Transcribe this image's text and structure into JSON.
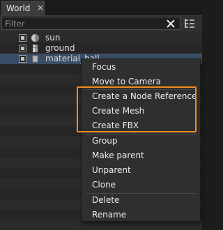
{
  "tab": {
    "label": "World",
    "close_glyph": "×"
  },
  "toolbar": {
    "filter_placeholder": "Filter",
    "filter_value": ""
  },
  "tree": {
    "items": [
      {
        "label": "sun",
        "icon": "sun-icon"
      },
      {
        "label": "ground",
        "icon": "mesh-icon"
      },
      {
        "label": "material_ball",
        "icon": "node-icon",
        "selected": true
      }
    ]
  },
  "context_menu": {
    "items": [
      "Focus",
      "Move to Camera",
      "Create a Node Reference",
      "Create Mesh",
      "Create FBX",
      "Group",
      "Make parent",
      "Unparent",
      "Clone",
      "Delete",
      "Rename"
    ],
    "highlighted": [
      "Create a Node Reference",
      "Create Mesh",
      "Create FBX"
    ]
  },
  "colors": {
    "highlight_border": "#f28c1e",
    "selection": "#3a4d66"
  }
}
